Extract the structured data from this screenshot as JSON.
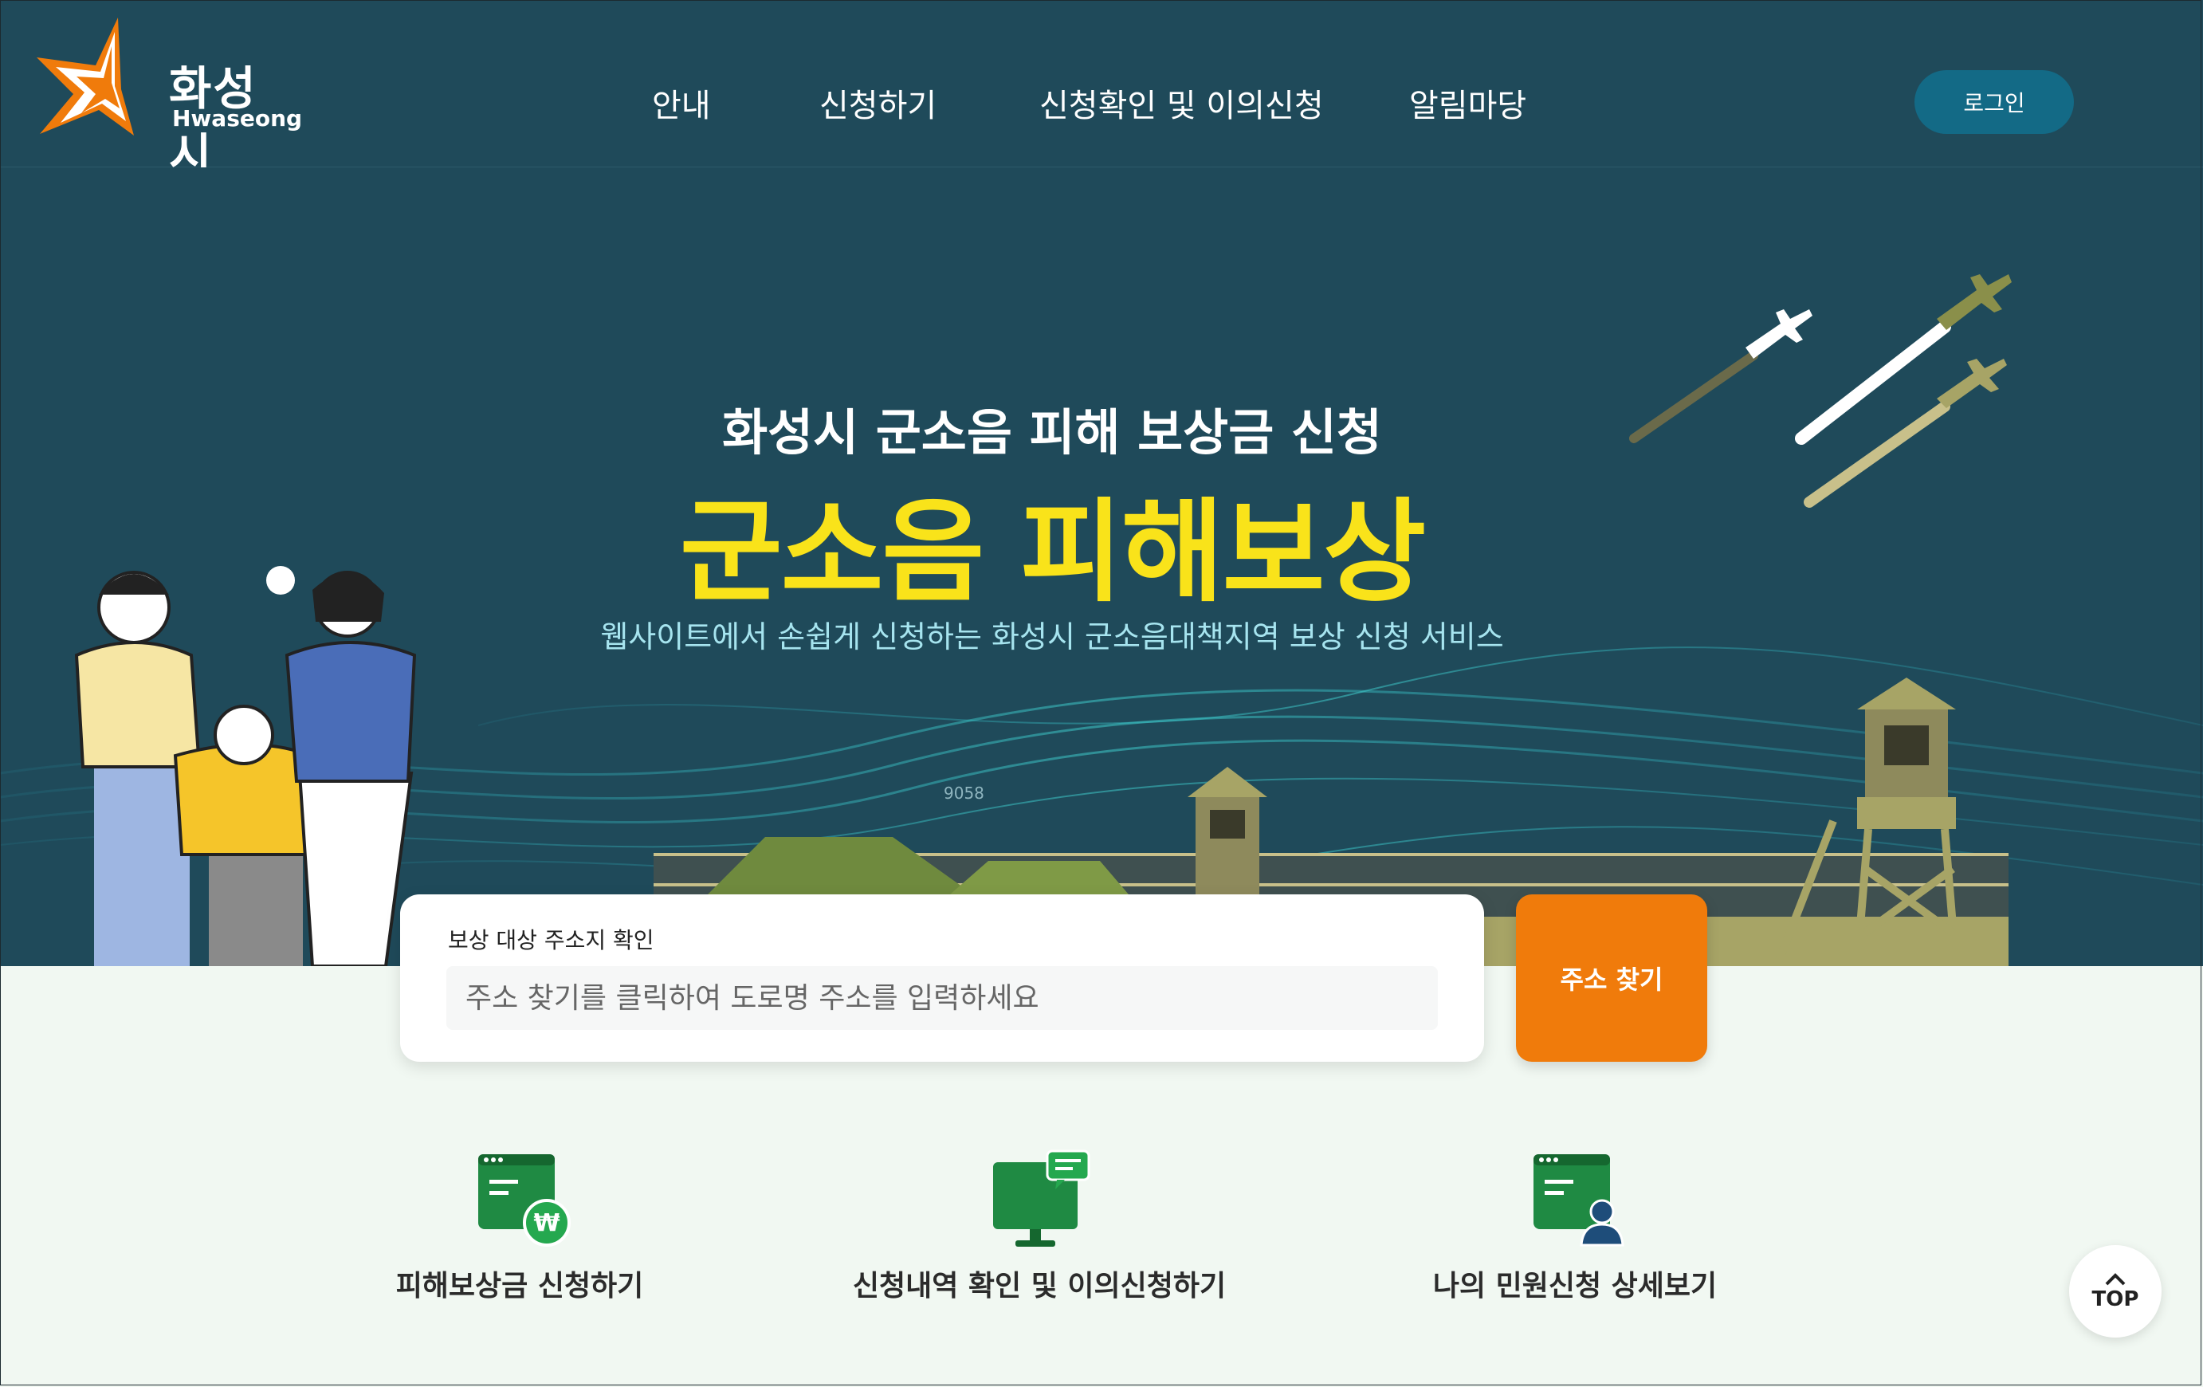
{
  "logo": {
    "name_ko": "화성시",
    "name_en": "Hwaseong"
  },
  "nav": {
    "items": [
      {
        "label": "안내"
      },
      {
        "label": "신청하기"
      },
      {
        "label": "신청확인 및 이의신청"
      },
      {
        "label": "알림마당"
      }
    ],
    "login_label": "로그인"
  },
  "hero": {
    "subtitle": "화성시 군소음 피해 보상금 신청",
    "title": "군소음 피해보상",
    "description": "웹사이트에서 손쉽게 신청하는 화성시 군소음대책지역 보상 신청 서비스",
    "decor_number": "9058"
  },
  "search": {
    "label": "보상 대상 주소지 확인",
    "placeholder": "주소 찾기를 클릭하여 도로명 주소를 입력하세요",
    "button_label": "주소 찾기"
  },
  "quick_links": [
    {
      "label": "피해보상금 신청하기",
      "icon": "monitor-won-icon"
    },
    {
      "label": "신청내역 확인 및 이의신청하기",
      "icon": "monitor-chat-icon"
    },
    {
      "label": "나의 민원신청 상세보기",
      "icon": "monitor-user-icon"
    }
  ],
  "top_button": {
    "label": "TOP"
  },
  "colors": {
    "header_bg": "#1f4a5a",
    "accent_yellow": "#f9e31a",
    "accent_orange": "#f07b0b",
    "icon_green": "#1f8a43",
    "login_bg": "#136a86"
  }
}
